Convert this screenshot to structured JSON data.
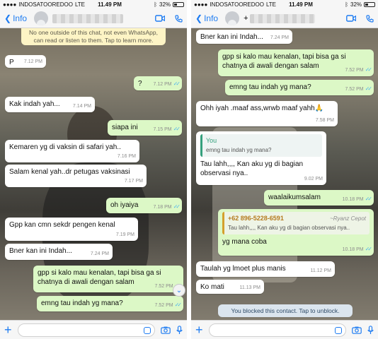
{
  "left": {
    "status": {
      "carrier": "INDOSATOOREDOO",
      "network": "LTE",
      "time": "11.49 PM",
      "battery": "32%"
    },
    "header": {
      "back_label": "Info"
    },
    "encryption_note": "No one outside of this chat, not even WhatsApp, can read or listen to them. Tap to learn more.",
    "messages": [
      {
        "dir": "in",
        "text": "P",
        "time": "7.12 PM"
      },
      {
        "dir": "out",
        "text": "?",
        "time": "7.12 PM"
      },
      {
        "dir": "in",
        "text": "Kak indah yah...",
        "time": "7.14 PM"
      },
      {
        "dir": "out",
        "text": "siapa ini",
        "time": "7.15 PM"
      },
      {
        "dir": "in",
        "text": "Kemaren yg di vaksin di safari yah..",
        "time": "7.16 PM"
      },
      {
        "dir": "in",
        "text": "Salam kenal yah..dr petugas vaksinasi",
        "time": "7.17 PM"
      },
      {
        "dir": "out",
        "text": "oh iyaiya",
        "time": "7.18 PM"
      },
      {
        "dir": "in",
        "text": "Gpp kan cmn sekdr pengen kenal",
        "time": "7.19 PM"
      },
      {
        "dir": "in",
        "text": "Bner kan ini Indah...",
        "time": "7.24 PM"
      },
      {
        "dir": "out",
        "text": "gpp si kalo mau kenalan, tapi bisa ga si chatnya di awali dengan salam",
        "time": "7.52 PM"
      },
      {
        "dir": "out",
        "text": "emng tau indah yg mana?",
        "time": "7.52 PM"
      }
    ]
  },
  "right": {
    "status": {
      "carrier": "INDOSATOOREDOO",
      "network": "LTE",
      "time": "11.49 PM",
      "battery": "32%"
    },
    "header": {
      "back_label": "Info",
      "contact_prefix": "+"
    },
    "messages": [
      {
        "dir": "in",
        "text": "Bner kan ini Indah...",
        "time": "7.24 PM"
      },
      {
        "dir": "out",
        "text": "gpp si kalo mau kenalan, tapi bisa ga si chatnya di awali dengan salam",
        "time": "7.52 PM"
      },
      {
        "dir": "out",
        "text": "emng tau indah yg mana?",
        "time": "7.52 PM"
      },
      {
        "dir": "in",
        "text": "Ohh iyah .maaf ass,wrwb maaf yahh🙏",
        "time": "7.58 PM"
      },
      {
        "dir": "in",
        "quote_author": "You",
        "quote_text": "emng tau indah yg mana?",
        "text": "Tau lahh,,,, Kan aku yg di bagian observasi nya..",
        "time": "9.02 PM"
      },
      {
        "dir": "out",
        "text": "waalaikumsalam",
        "time": "10.18 PM"
      },
      {
        "dir": "out",
        "quote_number": "+62 896-5228-6591",
        "quote_name": "~Ryanz Cepot",
        "quote_text": "Tau lahh,,,, Kan aku yg di bagian observasi nya..",
        "text": "yg mana coba",
        "time": "10.18 PM"
      },
      {
        "dir": "in",
        "text": "Taulah yg lmoet plus manis",
        "time": "11.12 PM"
      },
      {
        "dir": "in",
        "text": "Ko mati",
        "time": "11.13 PM"
      }
    ],
    "blocked_banner": "You blocked this contact. Tap to unblock."
  }
}
